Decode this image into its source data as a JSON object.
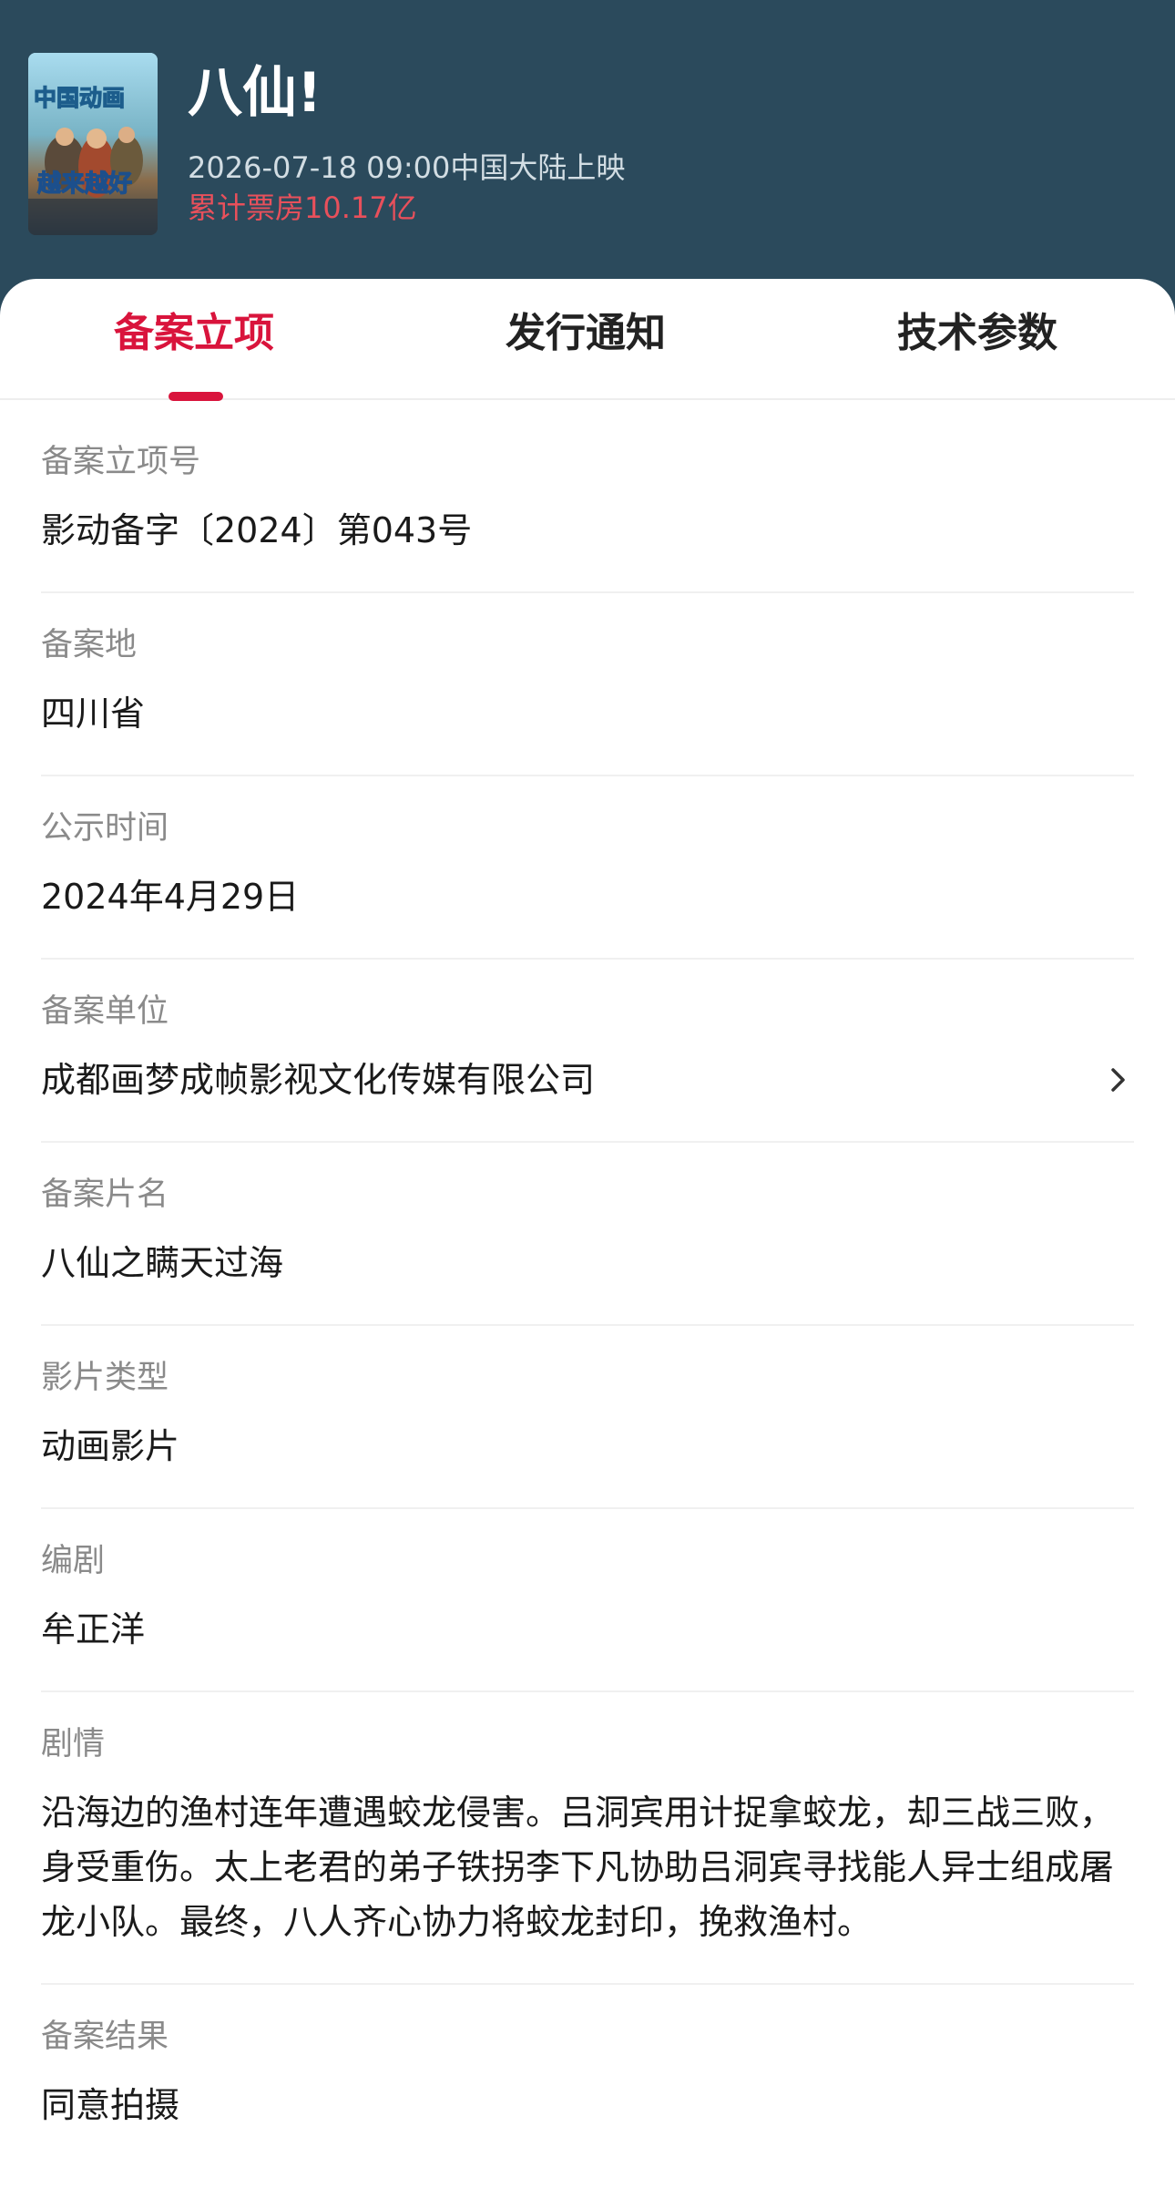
{
  "movie": {
    "title": "八仙!",
    "release": "2026-07-18 09:00中国大陆上映",
    "box_office": "累计票房10.17亿",
    "poster_text_top": "中国动画",
    "poster_text_bottom": "越来越好"
  },
  "tabs": [
    {
      "label": "备案立项",
      "active": true
    },
    {
      "label": "发行通知",
      "active": false
    },
    {
      "label": "技术参数",
      "active": false
    }
  ],
  "fields": {
    "filing_number": {
      "label": "备案立项号",
      "value": "影动备字〔2024〕第043号"
    },
    "filing_place": {
      "label": "备案地",
      "value": "四川省"
    },
    "publicity_time": {
      "label": "公示时间",
      "value": "2024年4月29日"
    },
    "filing_unit": {
      "label": "备案单位",
      "value": "成都画梦成帧影视文化传媒有限公司"
    },
    "filing_title": {
      "label": "备案片名",
      "value": "八仙之瞒天过海"
    },
    "film_type": {
      "label": "影片类型",
      "value": "动画影片"
    },
    "screenwriter": {
      "label": "编剧",
      "value": "牟正洋"
    },
    "plot": {
      "label": "剧情",
      "value": "沿海边的渔村连年遭遇蛟龙侵害。吕洞宾用计捉拿蛟龙，却三战三败，身受重伤。太上老君的弟子铁拐李下凡协助吕洞宾寻找能人异士组成屠龙小队。最终，八人齐心协力将蛟龙封印，挽救渔村。"
    },
    "filing_result": {
      "label": "备案结果",
      "value": "同意拍摄"
    }
  },
  "colors": {
    "header_bg": "#2b4a5c",
    "accent": "#d9143c",
    "box_office": "#e8505b"
  }
}
